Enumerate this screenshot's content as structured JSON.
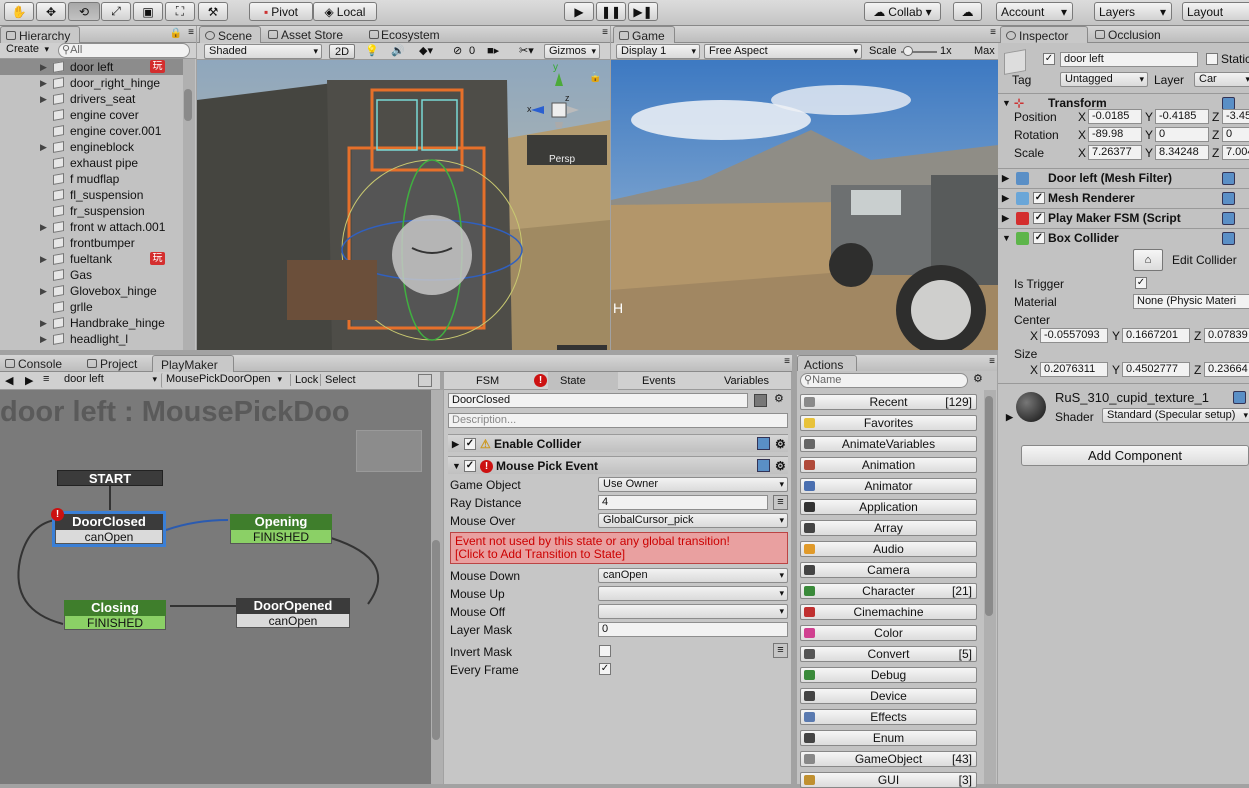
{
  "toolbar": {
    "pivot": "Pivot",
    "local": "Local",
    "collab": "Collab ▾",
    "account": "Account",
    "layers": "Layers",
    "layout": "Layout"
  },
  "hierarchy": {
    "tab": "Hierarchy",
    "create": "Create",
    "search_placeholder": "All",
    "items": [
      {
        "name": "door left",
        "arrow": "▶",
        "badge": "玩",
        "selected": true
      },
      {
        "name": "door_right_hinge",
        "arrow": "▶"
      },
      {
        "name": "drivers_seat",
        "arrow": "▶"
      },
      {
        "name": "engine cover",
        "arrow": ""
      },
      {
        "name": "engine cover.001",
        "arrow": ""
      },
      {
        "name": "engineblock",
        "arrow": "▶"
      },
      {
        "name": "exhaust pipe",
        "arrow": ""
      },
      {
        "name": "f mudflap",
        "arrow": ""
      },
      {
        "name": "fl_suspension",
        "arrow": ""
      },
      {
        "name": "fr_suspension",
        "arrow": ""
      },
      {
        "name": "front w attach.001",
        "arrow": "▶"
      },
      {
        "name": "frontbumper",
        "arrow": ""
      },
      {
        "name": "fueltank",
        "arrow": "▶",
        "badge": "玩"
      },
      {
        "name": "Gas",
        "arrow": ""
      },
      {
        "name": "Glovebox_hinge",
        "arrow": "▶"
      },
      {
        "name": "grlle",
        "arrow": ""
      },
      {
        "name": "Handbrake_hinge",
        "arrow": "▶"
      },
      {
        "name": "headlight_l",
        "arrow": "▶"
      }
    ]
  },
  "scene": {
    "tabs": [
      "Scene",
      "Asset Store",
      "Ecosystem"
    ],
    "shaded": "Shaded",
    "mode2d": "2D",
    "count": "0",
    "gizmos": "Gizmos",
    "persp": "Persp",
    "axis_x": "x",
    "axis_y": "y",
    "axis_z": "z"
  },
  "game": {
    "tab": "Game",
    "display": "Display 1",
    "aspect": "Free Aspect",
    "scale_label": "Scale",
    "scale_value": "1x",
    "maximize": "Max",
    "stats_label": "H"
  },
  "bottomtabs": {
    "console": "Console",
    "project": "Project",
    "playmaker": "PlayMaker"
  },
  "playmaker": {
    "gameobject": "door left",
    "fsm": "MousePickDoorOpen",
    "lock": "Lock",
    "select": "Select",
    "title": "door left : MousePickDoo",
    "start": "START",
    "states": [
      {
        "name": "DoorClosed",
        "event": "canOpen",
        "color": "#3b3b3b",
        "error": true
      },
      {
        "name": "Opening",
        "event": "FINISHED",
        "color": "#3f7e2c"
      },
      {
        "name": "Closing",
        "event": "FINISHED",
        "color": "#3f7e2c"
      },
      {
        "name": "DoorOpened",
        "event": "canOpen",
        "color": "#3b3b3b"
      }
    ]
  },
  "statepanel": {
    "tabs": [
      "FSM",
      "State",
      "Events",
      "Variables"
    ],
    "state_name": "DoorClosed",
    "description_placeholder": "Description...",
    "action1": "Enable Collider",
    "action2": "Mouse Pick Event",
    "labels": {
      "game_object": "Game Object",
      "ray_distance": "Ray Distance",
      "mouse_over": "Mouse Over",
      "mouse_down": "Mouse Down",
      "mouse_up": "Mouse Up",
      "mouse_off": "Mouse Off",
      "layer_mask": "Layer Mask",
      "invert_mask": "Invert Mask",
      "every_frame": "Every Frame"
    },
    "values": {
      "game_object": "Use Owner",
      "ray_distance": "4",
      "mouse_over": "GlobalCursor_pick",
      "mouse_down": "canOpen",
      "mouse_up": "",
      "mouse_off": "",
      "layer_mask": "0"
    },
    "error_line1": "Event not used by this state or any global transition!",
    "error_line2": "[Click to Add Transition to State]"
  },
  "actions": {
    "tab": "Actions",
    "search_placeholder": "Name",
    "items": [
      {
        "label": "Recent",
        "count": "[129]",
        "icon": "#8a8a8a"
      },
      {
        "label": "Favorites",
        "count": "",
        "icon": "#e8c23a"
      },
      {
        "label": "AnimateVariables",
        "count": "",
        "icon": "#666"
      },
      {
        "label": "Animation",
        "count": "",
        "icon": "#b04a3a"
      },
      {
        "label": "Animator",
        "count": "",
        "icon": "#4a6fb0"
      },
      {
        "label": "Application",
        "count": "",
        "icon": "#333"
      },
      {
        "label": "Array",
        "count": "",
        "icon": "#444"
      },
      {
        "label": "Audio",
        "count": "",
        "icon": "#e09a2a"
      },
      {
        "label": "Camera",
        "count": "",
        "icon": "#444"
      },
      {
        "label": "Character",
        "count": "[21]",
        "icon": "#3a8a3a"
      },
      {
        "label": "Cinemachine",
        "count": "",
        "icon": "#c03030"
      },
      {
        "label": "Color",
        "count": "",
        "icon": "#d04090"
      },
      {
        "label": "Convert",
        "count": "[5]",
        "icon": "#555"
      },
      {
        "label": "Debug",
        "count": "",
        "icon": "#3a8a3a"
      },
      {
        "label": "Device",
        "count": "",
        "icon": "#444"
      },
      {
        "label": "Effects",
        "count": "",
        "icon": "#5a7ab0"
      },
      {
        "label": "Enum",
        "count": "",
        "icon": "#444"
      },
      {
        "label": "GameObject",
        "count": "[43]",
        "icon": "#888"
      },
      {
        "label": "GUI",
        "count": "[3]",
        "icon": "#c09030"
      }
    ]
  },
  "inspector": {
    "tabs": [
      "Inspector",
      "Occlusion"
    ],
    "object_name": "door left",
    "static_label": "Static",
    "tag_label": "Tag",
    "tag_value": "Untagged",
    "layer_label": "Layer",
    "layer_value": "Car",
    "transform": "Transform",
    "position_label": "Position",
    "rotation_label": "Rotation",
    "scale_label": "Scale",
    "position": [
      "-0.0185",
      "-0.4185",
      "-3.45"
    ],
    "rotation": [
      "-89.98",
      "0",
      "0"
    ],
    "scale": [
      "7.26377",
      "8.34248",
      "7.004"
    ],
    "axis": [
      "X",
      "Y",
      "Z"
    ],
    "mesh_filter": "Door left (Mesh Filter)",
    "mesh_renderer": "Mesh Renderer",
    "fsm_script": "Play Maker FSM (Script",
    "box_collider": "Box Collider",
    "edit_collider": "Edit Collider",
    "is_trigger": "Is Trigger",
    "material_label": "Material",
    "material_value": "None (Physic Materi",
    "center_label": "Center",
    "center": [
      "-0.0557093",
      "0.1667201",
      "0.07839"
    ],
    "size_label": "Size",
    "size": [
      "0.2076311",
      "0.4502777",
      "0.23664"
    ],
    "mat_name": "RuS_310_cupid_texture_1",
    "shader_label": "Shader",
    "shader_value": "Standard (Specular setup)",
    "add_component": "Add Component"
  }
}
